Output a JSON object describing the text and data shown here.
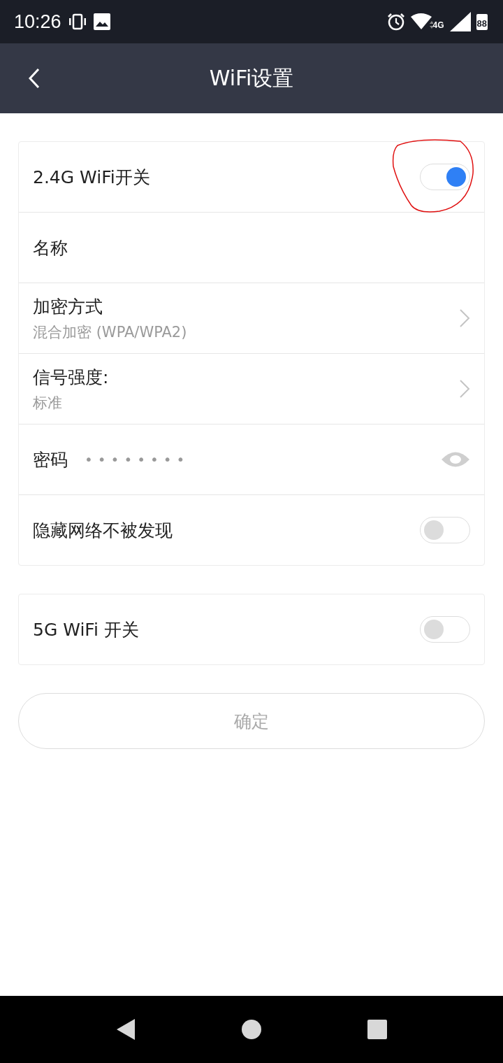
{
  "status_bar": {
    "time": "10:26",
    "network": "4G",
    "battery": "88"
  },
  "header": {
    "title": "WiFi设置"
  },
  "groups": [
    {
      "rows": [
        {
          "kind": "toggle",
          "label": "2.4G WiFi开关",
          "on": true
        },
        {
          "kind": "text",
          "label": "名称"
        },
        {
          "kind": "select",
          "label": "加密方式",
          "value": "混合加密 (WPA/WPA2)"
        },
        {
          "kind": "select",
          "label": "信号强度:",
          "value": "标准"
        },
        {
          "kind": "password",
          "label": "密码",
          "value": "••••••••"
        },
        {
          "kind": "toggle",
          "label": "隐藏网络不被发现",
          "on": false
        }
      ]
    },
    {
      "rows": [
        {
          "kind": "toggle",
          "label": "5G WiFi 开关",
          "on": false
        }
      ]
    }
  ],
  "confirm_button": {
    "label": "确定",
    "disabled": true
  }
}
